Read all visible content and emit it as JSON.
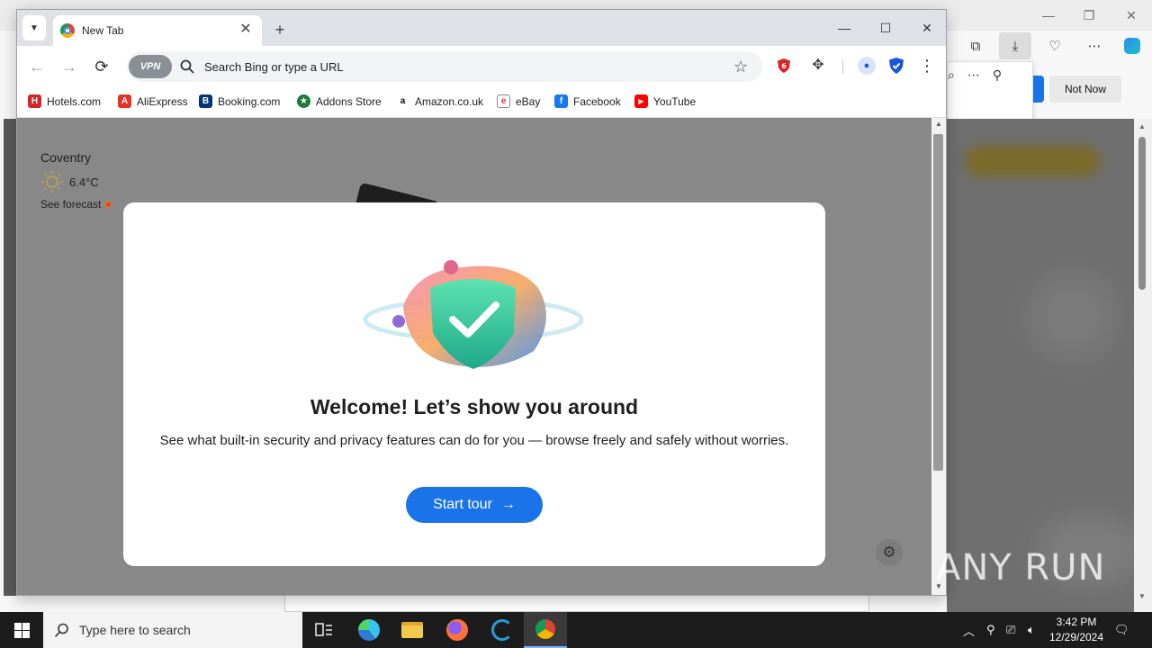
{
  "browser": {
    "tab_title": "New Tab",
    "omnibox_placeholder": "Search Bing or type a URL",
    "vpn_label": "VPN",
    "bookmarks": [
      {
        "label": "Hotels.com",
        "icon": "hotels-icon",
        "color": "#d32323"
      },
      {
        "label": "AliExpress",
        "icon": "aliexpress-icon",
        "color": "#e43225"
      },
      {
        "label": "Booking.com",
        "icon": "booking-icon",
        "color": "#003580"
      },
      {
        "label": "Addons Store",
        "icon": "addons-store-icon",
        "color": "#1e7a3c"
      },
      {
        "label": "Amazon.co.uk",
        "icon": "amazon-icon",
        "color": "#111111"
      },
      {
        "label": "eBay",
        "icon": "ebay-icon",
        "color": "#e53238"
      },
      {
        "label": "Facebook",
        "icon": "facebook-icon",
        "color": "#1877f2"
      },
      {
        "label": "YouTube",
        "icon": "youtube-icon",
        "color": "#ff0000"
      }
    ]
  },
  "weather": {
    "city": "Coventry",
    "temperature": "6.4°C",
    "forecast_link": "See forecast"
  },
  "modal": {
    "title": "Welcome! Let’s show you around",
    "description": "See what built-in security and privacy features can do for you — browse freely and safely without worries.",
    "button_label": "Start tour",
    "accent_color": "#1a73e8"
  },
  "background_window": {
    "not_now_label": "Not Now"
  },
  "taskbar": {
    "search_placeholder": "Type here to search",
    "time": "3:42 PM",
    "date": "12/29/2024"
  },
  "watermark": "ANY RUN"
}
